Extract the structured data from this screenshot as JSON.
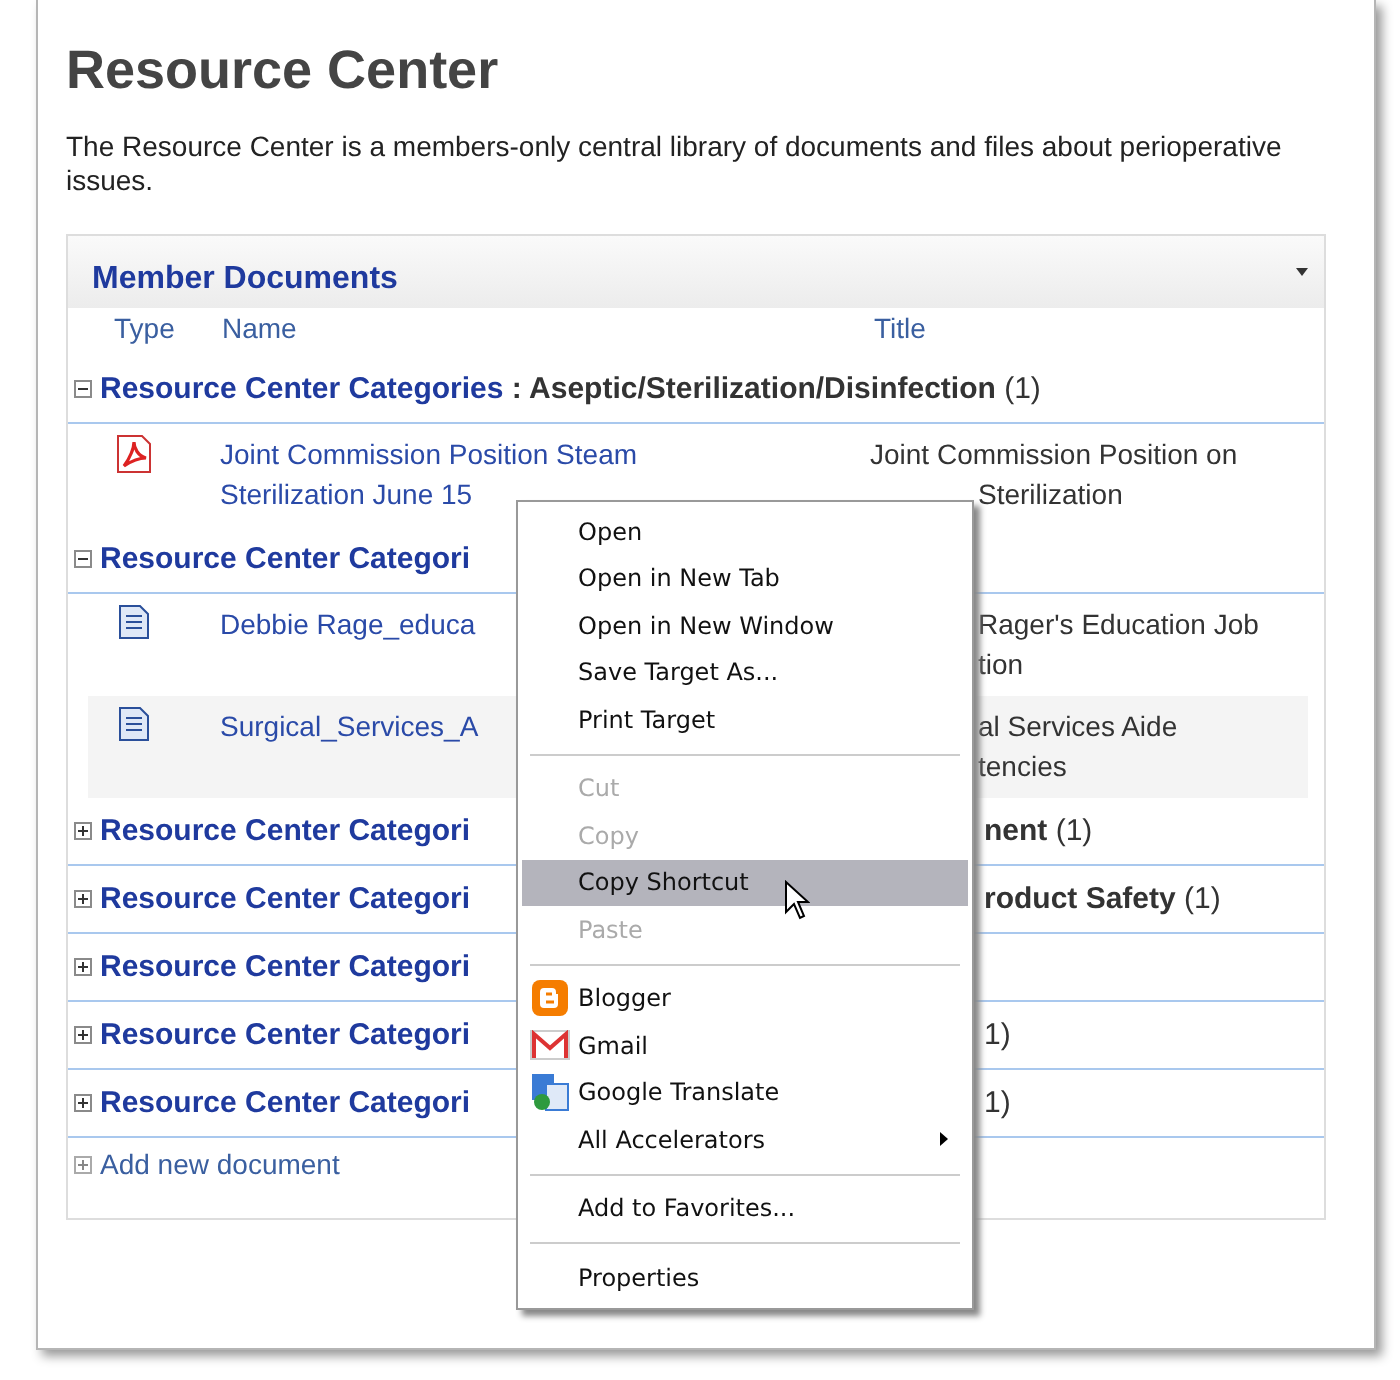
{
  "page": {
    "title": "Resource Center",
    "description": "The Resource Center is a members-only central library of documents and files about perioperative issues."
  },
  "panel": {
    "title": "Member Documents",
    "columns": [
      "Type",
      "Name",
      "Title"
    ],
    "groups": [
      {
        "label": "Resource Center Categories",
        "value": " : Aseptic/Sterilization/Disinfection",
        "count": " (1)",
        "expanded": true,
        "documents": [
          {
            "kind": "pdf",
            "name_lines": [
              "Joint Commission Position Steam",
              "Sterilization June 15"
            ],
            "title_lines": [
              "Joint Commission Position on",
              "Sterilization"
            ]
          }
        ]
      },
      {
        "label": "Resource Center Categori",
        "expanded": true,
        "documents": [
          {
            "kind": "doc",
            "name_lines": [
              "Debbie Rage_educa"
            ],
            "title_lines": [
              "Rager's Education Job",
              "tion"
            ]
          },
          {
            "kind": "doc",
            "name_lines": [
              "Surgical_Services_A"
            ],
            "title_lines": [
              "al Services Aide",
              "tencies"
            ]
          }
        ]
      },
      {
        "label": "Resource Center Categori",
        "value": "nent",
        "count": " (1)",
        "expanded": false
      },
      {
        "label": "Resource Center Categori",
        "value": "roduct Safety",
        "count": " (1)",
        "expanded": false
      },
      {
        "label": "Resource Center Categori",
        "expanded": false
      },
      {
        "label": "Resource Center Categori",
        "count": "1)",
        "expanded": false
      },
      {
        "label": "Resource Center Categori",
        "count": "1)",
        "expanded": false
      }
    ],
    "add_link": "Add new document"
  },
  "context_menu": {
    "items": [
      {
        "kind": "item",
        "label": "Open",
        "disabled": false,
        "selected": false
      },
      {
        "kind": "item",
        "label": "Open in New Tab",
        "disabled": false,
        "selected": false
      },
      {
        "kind": "item",
        "label": "Open in New Window",
        "disabled": false,
        "selected": false
      },
      {
        "kind": "item",
        "label": "Save Target As...",
        "disabled": false,
        "selected": false
      },
      {
        "kind": "item",
        "label": "Print Target",
        "disabled": false,
        "selected": false
      },
      {
        "kind": "separator"
      },
      {
        "kind": "item",
        "label": "Cut",
        "disabled": true,
        "selected": false
      },
      {
        "kind": "item",
        "label": "Copy",
        "disabled": true,
        "selected": false
      },
      {
        "kind": "item",
        "label": "Copy Shortcut",
        "disabled": false,
        "selected": true
      },
      {
        "kind": "item",
        "label": "Paste",
        "disabled": true,
        "selected": false
      },
      {
        "kind": "separator"
      },
      {
        "kind": "app",
        "label": "Blogger",
        "disabled": false,
        "selected": false
      },
      {
        "kind": "app",
        "label": "Gmail",
        "disabled": false,
        "selected": false
      },
      {
        "kind": "app",
        "label": "Google Translate",
        "disabled": false,
        "selected": false
      },
      {
        "kind": "item",
        "label": "All Accelerators",
        "submenu": true,
        "disabled": false,
        "selected": false
      },
      {
        "kind": "separator"
      },
      {
        "kind": "item",
        "label": "Add to Favorites...",
        "disabled": false,
        "selected": false
      },
      {
        "kind": "separator"
      },
      {
        "kind": "item",
        "label": "Properties",
        "disabled": false,
        "selected": false
      }
    ]
  }
}
